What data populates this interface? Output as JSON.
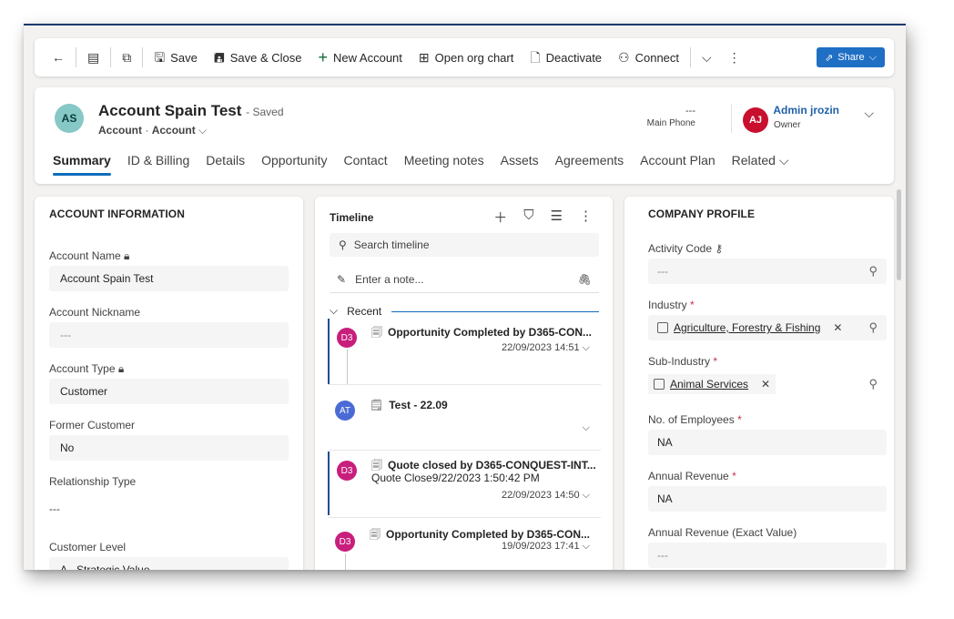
{
  "commandbar": {
    "save": "Save",
    "save_close": "Save & Close",
    "new_account": "New Account",
    "org_chart": "Open org chart",
    "deactivate": "Deactivate",
    "connect": "Connect",
    "share": "Share"
  },
  "header": {
    "initials": "AS",
    "title": "Account Spain Test",
    "saved": "- Saved",
    "entity": "Account",
    "form": "Account",
    "phone_value": "---",
    "phone_label": "Main Phone",
    "owner_initials": "AJ",
    "owner_name": "Admin jrozin",
    "owner_label": "Owner",
    "tabs": [
      "Summary",
      "ID & Billing",
      "Details",
      "Opportunity",
      "Contact",
      "Meeting notes",
      "Assets",
      "Agreements",
      "Account Plan",
      "Related"
    ]
  },
  "left": {
    "title": "ACCOUNT INFORMATION",
    "account_name_label": "Account Name",
    "account_name": "Account Spain Test",
    "nickname_label": "Account Nickname",
    "nickname": "---",
    "type_label": "Account Type",
    "type": "Customer",
    "former_label": "Former Customer",
    "former": "No",
    "relationship_label": "Relationship Type",
    "relationship": "---",
    "level_label": "Customer Level",
    "level": "A - Strategic Value"
  },
  "timeline": {
    "title": "Timeline",
    "search_placeholder": "Search timeline",
    "note_placeholder": "Enter a note...",
    "recent": "Recent",
    "items": [
      {
        "initials": "D3",
        "title": "Opportunity Completed by D365-CON...",
        "desc": "",
        "date": "22/09/2023 14:51"
      },
      {
        "initials": "AT",
        "title": "Test - 22.09",
        "desc": "",
        "date": ""
      },
      {
        "initials": "D3",
        "title": "Quote closed by D365-CONQUEST-INT...",
        "desc": "Quote Close9/22/2023 1:50:42 PM",
        "date": "22/09/2023 14:50"
      },
      {
        "initials": "D3",
        "title": "Opportunity Completed by D365-CON...",
        "desc": "",
        "date": "19/09/2023 17:41"
      }
    ]
  },
  "right": {
    "title": "COMPANY PROFILE",
    "activity_label": "Activity Code",
    "activity": "---",
    "industry_label": "Industry",
    "industry": "Agriculture, Forestry & Fishing",
    "subindustry_label": "Sub-Industry",
    "subindustry": "Animal Services",
    "employees_label": "No. of Employees",
    "employees": "NA",
    "revenue_label": "Annual Revenue",
    "revenue": "NA",
    "revenue_exact_label": "Annual Revenue (Exact Value)",
    "revenue_exact": "---",
    "required_mark": "*"
  }
}
